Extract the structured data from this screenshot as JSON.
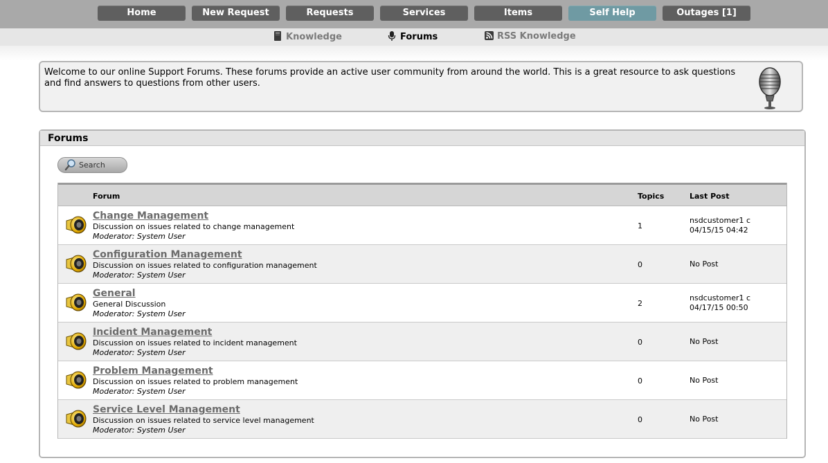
{
  "nav": {
    "tabs": [
      {
        "label": "Home"
      },
      {
        "label": "New Request"
      },
      {
        "label": "Requests"
      },
      {
        "label": "Services"
      },
      {
        "label": "Items"
      },
      {
        "label": "Self Help",
        "active": true
      },
      {
        "label": "Outages [1]"
      }
    ],
    "active_color": "#6f9aa3",
    "tab_color": "#5f5f5f"
  },
  "subnav": {
    "items": [
      {
        "label": "Knowledge",
        "icon": "book-icon"
      },
      {
        "label": "Forums",
        "icon": "microphone-icon",
        "current": true
      },
      {
        "label": "RSS Knowledge",
        "icon": "rss-icon"
      }
    ]
  },
  "welcome": {
    "text": "Welcome to our online Support Forums. These forums provide an active user community from around the world. This is a great resource to ask questions and find answers to questions from other users.",
    "icon": "microphone-icon"
  },
  "panel": {
    "title": "Forums",
    "search_label": "Search"
  },
  "table": {
    "headers": {
      "forum": "Forum",
      "topics": "Topics",
      "last_post": "Last Post"
    },
    "rows": [
      {
        "title": "Change Management",
        "desc": "Discussion on issues related to change management",
        "moderator": "Moderator: System User",
        "topics": "1",
        "last_user": "nsdcustomer1 c",
        "last_date": "04/15/15 04:42"
      },
      {
        "title": "Configuration Management",
        "desc": "Discussion on issues related to configuration management",
        "moderator": "Moderator: System User",
        "topics": "0",
        "last_user": "",
        "last_date": "No Post"
      },
      {
        "title": "General",
        "desc": "General Discussion",
        "moderator": "Moderator: System User",
        "topics": "2",
        "last_user": "nsdcustomer1 c",
        "last_date": "04/17/15 00:50"
      },
      {
        "title": "Incident Management",
        "desc": "Discussion on issues related to incident management",
        "moderator": "Moderator: System User",
        "topics": "0",
        "last_user": "",
        "last_date": "No Post"
      },
      {
        "title": "Problem Management",
        "desc": "Discussion on issues related to problem management",
        "moderator": "Moderator: System User",
        "topics": "0",
        "last_user": "",
        "last_date": "No Post"
      },
      {
        "title": "Service Level Management",
        "desc": "Discussion on issues related to service level management",
        "moderator": "Moderator: System User",
        "topics": "0",
        "last_user": "",
        "last_date": "No Post"
      }
    ],
    "row_icon": "forum-megaphone-icon"
  }
}
